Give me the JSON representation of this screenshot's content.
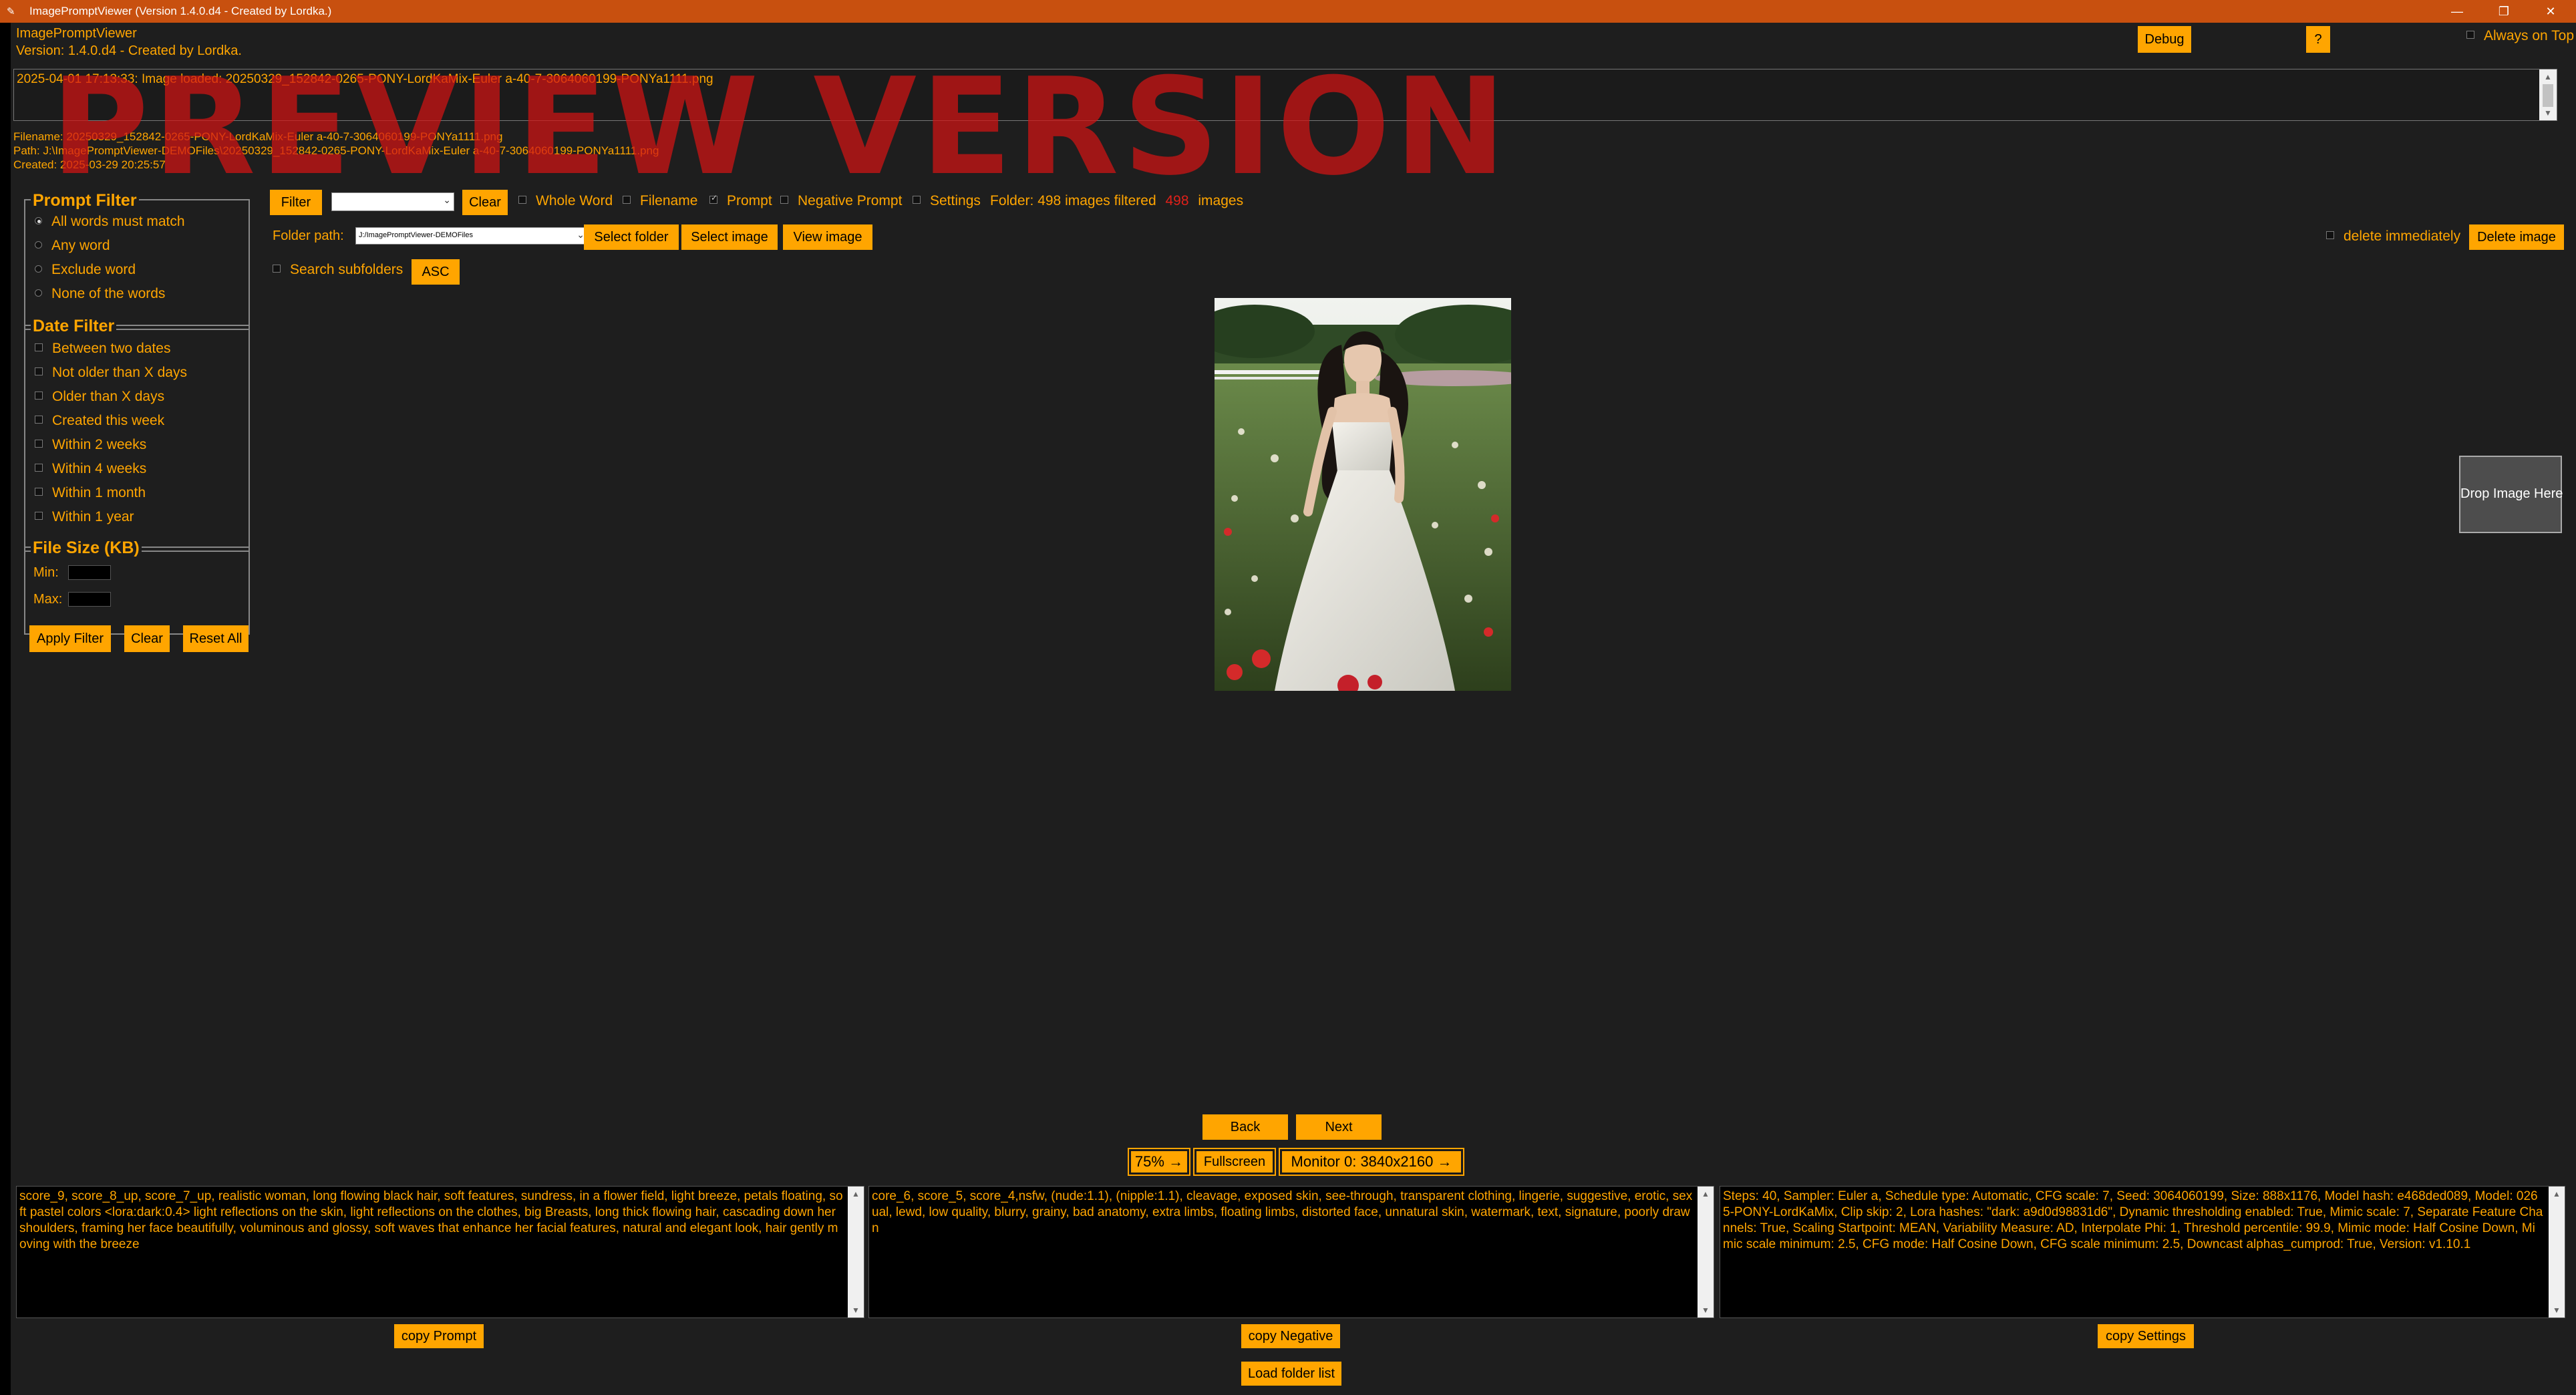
{
  "window": {
    "title": "ImagePromptViewer (Version 1.4.0.d4 - Created by Lordka.)",
    "icons": {
      "app": "feather-icon",
      "minimize": "minimize-icon",
      "restore": "restore-icon",
      "close": "close-icon"
    }
  },
  "header": {
    "app_name": "ImagePromptViewer",
    "version_line": "Version: 1.4.0.d4 - Created by Lordka.",
    "debug_label": "Debug",
    "help_label": "?",
    "always_on_top_label": "Always on Top"
  },
  "log": {
    "line": "2025-04-01 17:13:33: Image loaded: 20250329_152842-0265-PONY-LordKaMix-Euler a-40-7-3064060199-PONYa1111.png"
  },
  "watermark": "PREVIEW VERSION",
  "file_info": {
    "filename": "Filename: 20250329_152842-0265-PONY-LordKaMix-Euler a-40-7-3064060199-PONYa1111.png",
    "path": "Path: J:\\ImagePromptViewer-DEMOFiles\\20250329_152842-0265-PONY-LordKaMix-Euler a-40-7-3064060199-PONYa1111.png",
    "created": "Created: 2025-03-29 20:25:57"
  },
  "prompt_filter": {
    "title": "Prompt Filter",
    "options": [
      "All words must match",
      "Any word",
      "Exclude word",
      "None of the words"
    ],
    "selected_index": 0
  },
  "date_filter": {
    "title": "Date Filter",
    "options": [
      "Between two dates",
      "Not older than X days",
      "Older than X days",
      "Created this week",
      "Within 2 weeks",
      "Within 4 weeks",
      "Within 1 month",
      "Within 1 year"
    ]
  },
  "file_size": {
    "title": "File Size (KB)",
    "min_label": "Min:",
    "max_label": "Max:"
  },
  "filter_buttons": {
    "apply": "Apply Filter",
    "clear": "Clear",
    "reset": "Reset All"
  },
  "toolbar": {
    "filter_label": "Filter",
    "filter_value": "",
    "clear_label": "Clear",
    "whole_word": "Whole Word",
    "filename": "Filename",
    "prompt": "Prompt",
    "negative_prompt": "Negative Prompt",
    "settings": "Settings",
    "status_prefix": "Folder: 498 images filtered",
    "filtered_count": "498",
    "status_suffix": "images",
    "folder_path_label": "Folder path:",
    "folder_path_value": "J:/ImagePromptViewer-DEMOFiles",
    "select_folder": "Select folder",
    "select_image": "Select image",
    "view_image": "View image",
    "search_subfolders": "Search subfolders",
    "sort_label": "ASC",
    "delete_immediately": "delete immediately",
    "delete_image": "Delete image"
  },
  "drop_zone": "Drop Image Here",
  "nav": {
    "back": "Back",
    "next": "Next",
    "zoom": "75%",
    "zoom_arrow": "→",
    "fullscreen": "Fullscreen",
    "monitor": "Monitor 0: 3840x2160",
    "monitor_arrow": "→"
  },
  "panels": {
    "prompt": "score_9, score_8_up, score_7_up, realistic woman, long flowing black hair, soft features, sundress, in a flower field, light breeze, petals floating, soft pastel colors <lora:dark:0.4> light reflections on the skin, light reflections on the clothes, big Breasts, long thick flowing hair, cascading down her shoulders, framing her face beautifully, voluminous and glossy, soft waves that enhance her facial features, natural and elegant look, hair gently moving with the breeze",
    "negative": "core_6, score_5, score_4,nsfw, (nude:1.1), (nipple:1.1), cleavage, exposed skin, see-through, transparent clothing, lingerie, suggestive, erotic, sexual, lewd, low quality, blurry, grainy, bad anatomy, extra limbs, floating limbs, distorted face, unnatural skin, watermark, text, signature, poorly drawn",
    "settings": "Steps: 40, Sampler: Euler a, Schedule type: Automatic, CFG scale: 7, Seed: 3064060199, Size: 888x1176, Model hash: e468ded089, Model: 0265-PONY-LordKaMix, Clip skip: 2, Lora hashes: \"dark: a9d0d98831d6\", Dynamic thresholding enabled: True, Mimic scale: 7, Separate Feature Channels: True, Scaling Startpoint: MEAN, Variability Measure: AD, Interpolate Phi: 1, Threshold percentile: 99.9, Mimic mode: Half Cosine Down, Mimic scale minimum: 2.5, CFG mode: Half Cosine Down, CFG scale minimum: 2.5, Downcast alphas_cumprod: True, Version: v1.10.1"
  },
  "copy_buttons": {
    "prompt": "copy Prompt",
    "negative": "copy Negative",
    "settings": "copy Settings",
    "load_folder_list": "Load folder list"
  }
}
